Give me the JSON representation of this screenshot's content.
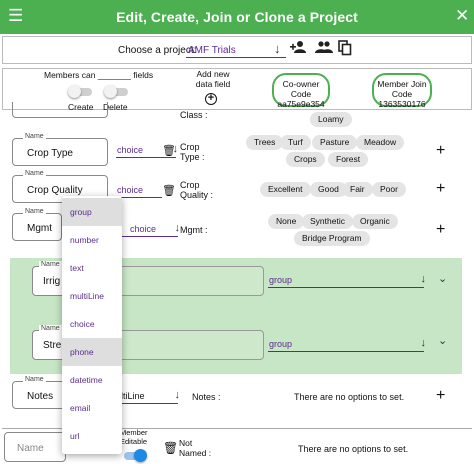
{
  "header": {
    "title": "Edit, Create, Join or Clone a Project",
    "colors": {
      "bar": "#4caf50",
      "accent": "#5a2d91"
    }
  },
  "project": {
    "label": "Choose a project:",
    "selected": "AMF Trials"
  },
  "controls": {
    "members_can": "Members can _______ fields",
    "create_label": "Create",
    "delete_label": "Delete",
    "add_new_label": "Add new data field",
    "coowner_code_label": "Co-owner Code",
    "coowner_code": "aa75e9e354",
    "member_code_label": "Member Join Code",
    "member_code": "1363530176"
  },
  "fields": {
    "name_legend": "Name",
    "top_partial": {
      "label": "Class :",
      "chips": [
        "Loamy"
      ]
    },
    "crop_type": {
      "name": "Crop Type",
      "type": "choice",
      "label": "Crop Type :",
      "chips": [
        "Trees",
        "Turf",
        "Pasture",
        "Meadow",
        "Crops",
        "Forest"
      ]
    },
    "crop_quality": {
      "name": "Crop Quality",
      "type": "choice",
      "label": "Crop Quality :",
      "chips": [
        "Excellent",
        "Good",
        "Fair",
        "Poor"
      ]
    },
    "mgmt": {
      "name": "Mgmt",
      "type": "choice",
      "label": "Mgmt :",
      "chips": [
        "None",
        "Synthetic",
        "Organic",
        "Bridge Program"
      ]
    },
    "irrigation": {
      "name_partial": "Irrig",
      "type": "group"
    },
    "street": {
      "name_partial": "Stre",
      "type": "group"
    },
    "notes": {
      "name": "Notes",
      "type_partial": "ltiLine",
      "label": "Notes :",
      "no_options": "There are no options to set."
    }
  },
  "type_menu": {
    "options": [
      "group",
      "number",
      "text",
      "multiLine",
      "choice",
      "phone",
      "datetime",
      "email",
      "url"
    ],
    "active": [
      "group",
      "phone"
    ]
  },
  "bottom": {
    "name_placeholder": "Name",
    "member_editable": "Member Editable",
    "not_named": "Not Named :",
    "no_options": "There are no options to set."
  }
}
